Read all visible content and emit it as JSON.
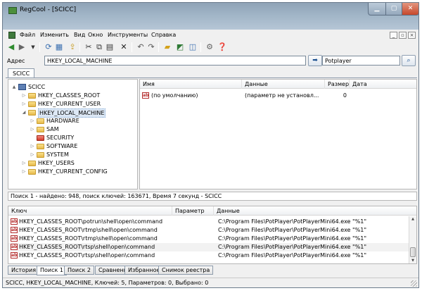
{
  "window": {
    "title": "RegCool - [SCICC]"
  },
  "menu": [
    "Файл",
    "Изменить",
    "Вид",
    "Окно",
    "Инструменты",
    "Справка"
  ],
  "mdi_controls": [
    "_",
    "▫",
    "×"
  ],
  "toolbar": {
    "icons": [
      "back-icon",
      "forward-icon",
      "dropdown-icon",
      "refresh-icon",
      "registry-icon",
      "export-icon",
      "cut-icon",
      "copy-icon",
      "paste-icon",
      "delete-icon",
      "undo-icon",
      "redo-icon",
      "open-folder-icon",
      "registry-snapshot-icon",
      "compare-icon",
      "tools-icon",
      "help-icon"
    ]
  },
  "address": {
    "label": "Адрес",
    "value": "HKEY_LOCAL_MACHINE",
    "search_value": "Potplayer"
  },
  "doc_tab": "SCICC",
  "tree": [
    {
      "label": "SCICC",
      "level": 0,
      "expander": "▲"
    },
    {
      "label": "HKEY_CLASSES_ROOT",
      "level": 1,
      "expander": "▷"
    },
    {
      "label": "HKEY_CURRENT_USER",
      "level": 1,
      "expander": "▷"
    },
    {
      "label": "HKEY_LOCAL_MACHINE",
      "level": 1,
      "expander": "◢",
      "selected": true
    },
    {
      "label": "HARDWARE",
      "level": 2,
      "expander": "▷"
    },
    {
      "label": "SAM",
      "level": 2,
      "expander": "▷"
    },
    {
      "label": "SECURITY",
      "level": 2,
      "expander": "",
      "red": true
    },
    {
      "label": "SOFTWARE",
      "level": 2,
      "expander": "▷"
    },
    {
      "label": "SYSTEM",
      "level": 2,
      "expander": "▷"
    },
    {
      "label": "HKEY_USERS",
      "level": 1,
      "expander": "▷"
    },
    {
      "label": "HKEY_CURRENT_CONFIG",
      "level": 1,
      "expander": "▷"
    }
  ],
  "values_table": {
    "columns": [
      "Имя",
      "Данные",
      "Размер",
      "Дата"
    ],
    "rows": [
      {
        "icon": "ab",
        "name": "(по умолчанию)",
        "data": "(параметр не установл...",
        "size": "0",
        "date": ""
      }
    ]
  },
  "search_status": "Поиск 1 - найдено: 948, поиск ключей: 163671, Время 7 секунд - SCICC",
  "results_table": {
    "columns": [
      "Ключ",
      "Параметр",
      "Данные"
    ],
    "rows": [
      {
        "key": "HKEY_CLASSES_ROOT\\potrun\\shell\\open\\command",
        "param": "",
        "data": "C:\\Program Files\\PotPlayer\\PotPlayerMini64.exe \"%1\""
      },
      {
        "key": "HKEY_CLASSES_ROOT\\rtmp\\shell\\open\\command",
        "param": "",
        "data": "C:\\Program Files\\PotPlayer\\PotPlayerMini64.exe \"%1\""
      },
      {
        "key": "HKEY_CLASSES_ROOT\\rtmp\\shell\\open\\command",
        "param": "",
        "data": "C:\\Program Files\\PotPlayer\\PotPlayerMini64.exe \"%1\""
      },
      {
        "key": "HKEY_CLASSES_ROOT\\rtsp\\shell\\open\\command",
        "param": "",
        "data": "C:\\Program Files\\PotPlayer\\PotPlayerMini64.exe \"%1\""
      },
      {
        "key": "HKEY_CLASSES_ROOT\\rtsp\\shell\\open\\command",
        "param": "",
        "data": "C:\\Program Files\\PotPlayer\\PotPlayerMini64.exe \"%1\""
      }
    ]
  },
  "bottom_tabs": [
    {
      "label": "История",
      "active": false
    },
    {
      "label": "Поиск 1",
      "active": true
    },
    {
      "label": "Поиск 2",
      "active": false
    },
    {
      "label": "Сравнение",
      "active": false
    },
    {
      "label": "Избранное",
      "active": false
    },
    {
      "label": "Снимок реестра",
      "active": false
    }
  ],
  "status_bar": "SCICC, HKEY_LOCAL_MACHINE, Ключей: 5, Параметров: 0, Выбрано: 0"
}
